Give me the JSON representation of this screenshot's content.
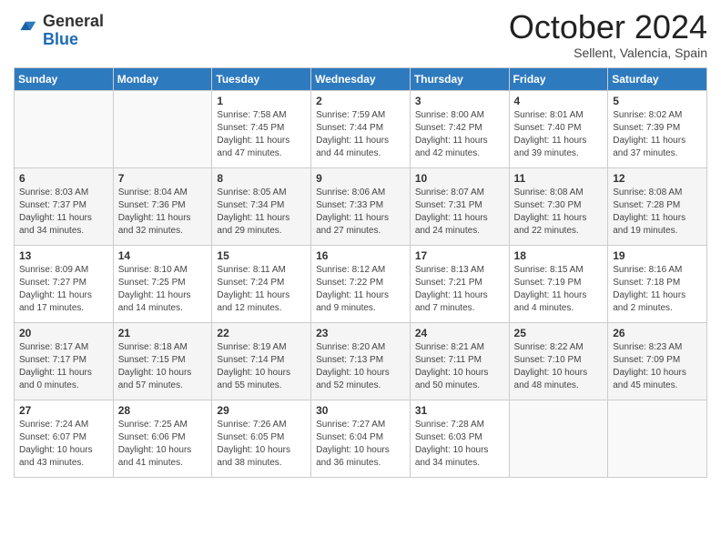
{
  "header": {
    "logo_general": "General",
    "logo_blue": "Blue",
    "month_title": "October 2024",
    "location": "Sellent, Valencia, Spain"
  },
  "weekdays": [
    "Sunday",
    "Monday",
    "Tuesday",
    "Wednesday",
    "Thursday",
    "Friday",
    "Saturday"
  ],
  "weeks": [
    [
      {
        "day": "",
        "info": ""
      },
      {
        "day": "",
        "info": ""
      },
      {
        "day": "1",
        "info": "Sunrise: 7:58 AM\nSunset: 7:45 PM\nDaylight: 11 hours and 47 minutes."
      },
      {
        "day": "2",
        "info": "Sunrise: 7:59 AM\nSunset: 7:44 PM\nDaylight: 11 hours and 44 minutes."
      },
      {
        "day": "3",
        "info": "Sunrise: 8:00 AM\nSunset: 7:42 PM\nDaylight: 11 hours and 42 minutes."
      },
      {
        "day": "4",
        "info": "Sunrise: 8:01 AM\nSunset: 7:40 PM\nDaylight: 11 hours and 39 minutes."
      },
      {
        "day": "5",
        "info": "Sunrise: 8:02 AM\nSunset: 7:39 PM\nDaylight: 11 hours and 37 minutes."
      }
    ],
    [
      {
        "day": "6",
        "info": "Sunrise: 8:03 AM\nSunset: 7:37 PM\nDaylight: 11 hours and 34 minutes."
      },
      {
        "day": "7",
        "info": "Sunrise: 8:04 AM\nSunset: 7:36 PM\nDaylight: 11 hours and 32 minutes."
      },
      {
        "day": "8",
        "info": "Sunrise: 8:05 AM\nSunset: 7:34 PM\nDaylight: 11 hours and 29 minutes."
      },
      {
        "day": "9",
        "info": "Sunrise: 8:06 AM\nSunset: 7:33 PM\nDaylight: 11 hours and 27 minutes."
      },
      {
        "day": "10",
        "info": "Sunrise: 8:07 AM\nSunset: 7:31 PM\nDaylight: 11 hours and 24 minutes."
      },
      {
        "day": "11",
        "info": "Sunrise: 8:08 AM\nSunset: 7:30 PM\nDaylight: 11 hours and 22 minutes."
      },
      {
        "day": "12",
        "info": "Sunrise: 8:08 AM\nSunset: 7:28 PM\nDaylight: 11 hours and 19 minutes."
      }
    ],
    [
      {
        "day": "13",
        "info": "Sunrise: 8:09 AM\nSunset: 7:27 PM\nDaylight: 11 hours and 17 minutes."
      },
      {
        "day": "14",
        "info": "Sunrise: 8:10 AM\nSunset: 7:25 PM\nDaylight: 11 hours and 14 minutes."
      },
      {
        "day": "15",
        "info": "Sunrise: 8:11 AM\nSunset: 7:24 PM\nDaylight: 11 hours and 12 minutes."
      },
      {
        "day": "16",
        "info": "Sunrise: 8:12 AM\nSunset: 7:22 PM\nDaylight: 11 hours and 9 minutes."
      },
      {
        "day": "17",
        "info": "Sunrise: 8:13 AM\nSunset: 7:21 PM\nDaylight: 11 hours and 7 minutes."
      },
      {
        "day": "18",
        "info": "Sunrise: 8:15 AM\nSunset: 7:19 PM\nDaylight: 11 hours and 4 minutes."
      },
      {
        "day": "19",
        "info": "Sunrise: 8:16 AM\nSunset: 7:18 PM\nDaylight: 11 hours and 2 minutes."
      }
    ],
    [
      {
        "day": "20",
        "info": "Sunrise: 8:17 AM\nSunset: 7:17 PM\nDaylight: 11 hours and 0 minutes."
      },
      {
        "day": "21",
        "info": "Sunrise: 8:18 AM\nSunset: 7:15 PM\nDaylight: 10 hours and 57 minutes."
      },
      {
        "day": "22",
        "info": "Sunrise: 8:19 AM\nSunset: 7:14 PM\nDaylight: 10 hours and 55 minutes."
      },
      {
        "day": "23",
        "info": "Sunrise: 8:20 AM\nSunset: 7:13 PM\nDaylight: 10 hours and 52 minutes."
      },
      {
        "day": "24",
        "info": "Sunrise: 8:21 AM\nSunset: 7:11 PM\nDaylight: 10 hours and 50 minutes."
      },
      {
        "day": "25",
        "info": "Sunrise: 8:22 AM\nSunset: 7:10 PM\nDaylight: 10 hours and 48 minutes."
      },
      {
        "day": "26",
        "info": "Sunrise: 8:23 AM\nSunset: 7:09 PM\nDaylight: 10 hours and 45 minutes."
      }
    ],
    [
      {
        "day": "27",
        "info": "Sunrise: 7:24 AM\nSunset: 6:07 PM\nDaylight: 10 hours and 43 minutes."
      },
      {
        "day": "28",
        "info": "Sunrise: 7:25 AM\nSunset: 6:06 PM\nDaylight: 10 hours and 41 minutes."
      },
      {
        "day": "29",
        "info": "Sunrise: 7:26 AM\nSunset: 6:05 PM\nDaylight: 10 hours and 38 minutes."
      },
      {
        "day": "30",
        "info": "Sunrise: 7:27 AM\nSunset: 6:04 PM\nDaylight: 10 hours and 36 minutes."
      },
      {
        "day": "31",
        "info": "Sunrise: 7:28 AM\nSunset: 6:03 PM\nDaylight: 10 hours and 34 minutes."
      },
      {
        "day": "",
        "info": ""
      },
      {
        "day": "",
        "info": ""
      }
    ]
  ]
}
